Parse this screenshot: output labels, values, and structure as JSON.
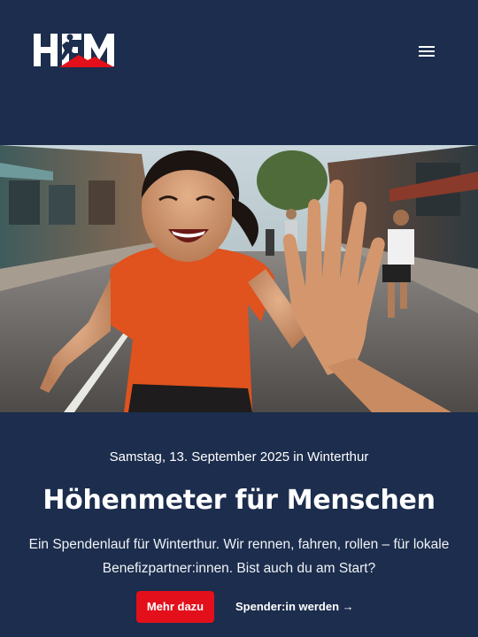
{
  "header": {
    "logo_text": "HFM",
    "menu_icon": "hamburger-menu-icon"
  },
  "hero": {
    "image_subject": "runner-high-five-photo"
  },
  "event": {
    "date_line": "Samstag, 13. September 2025 in Winterthur",
    "title": "Höhenmeter für Menschen",
    "intro": "Ein Spendenlauf für Winterthur. Wir rennen, fahren, rollen – für lokale Benefizpartner:innen. Bist auch du am Start?"
  },
  "cta": {
    "primary_label": "Mehr dazu",
    "secondary_label": "Spender:in werden →"
  },
  "colors": {
    "background": "#1c2d4d",
    "accent": "#e3101c",
    "text": "#ffffff"
  }
}
